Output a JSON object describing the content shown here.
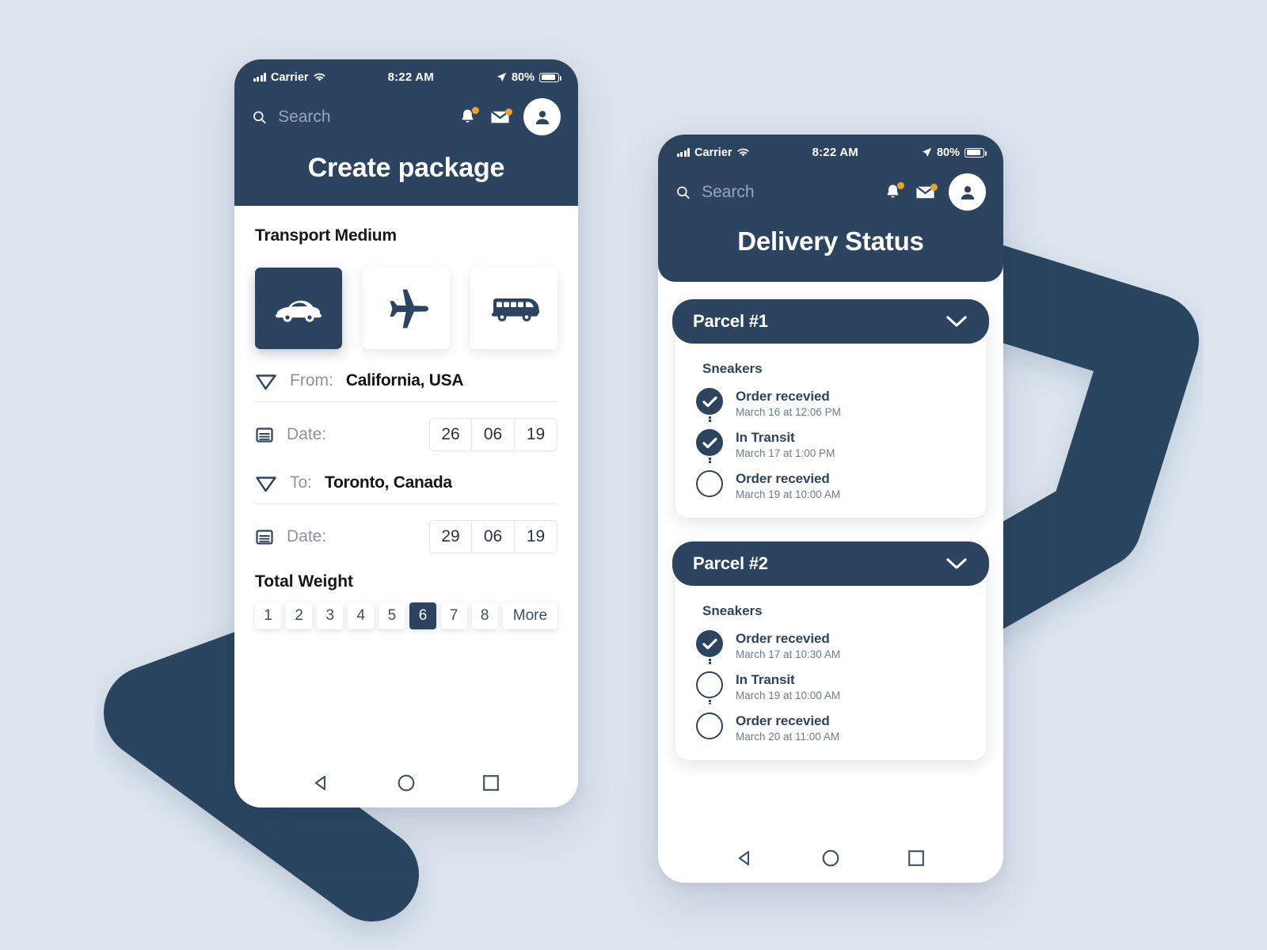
{
  "theme": {
    "page_background": "#dde5ef",
    "navy": "#2c4460",
    "accent_badge": "#f0a12b",
    "card_white": "#ffffff"
  },
  "phone_create": {
    "status_bar": {
      "carrier": "Carrier",
      "time": "8:22 AM",
      "battery_percent": "80%",
      "icons": [
        "signal-bars-icon",
        "wifi-icon",
        "location-arrow-icon",
        "battery-icon"
      ]
    },
    "search": {
      "placeholder": "Search",
      "value": ""
    },
    "header_icons": [
      "bell-icon",
      "mail-icon",
      "avatar-icon"
    ],
    "title": "Create package",
    "transport": {
      "section_label": "Transport Medium",
      "options": [
        {
          "name": "car",
          "icon": "car-icon",
          "selected": true
        },
        {
          "name": "airplane",
          "icon": "airplane-icon",
          "selected": false
        },
        {
          "name": "bus",
          "icon": "bus-icon",
          "selected": false
        }
      ]
    },
    "from": {
      "icon": "send-arrow-icon",
      "label": "From:",
      "value": "California, USA",
      "date_icon": "calendar-icon",
      "date_label": "Date:",
      "date": {
        "day": "26",
        "month": "06",
        "year": "19"
      }
    },
    "to": {
      "icon": "send-arrow-icon",
      "label": "To:",
      "value": "Toronto, Canada",
      "date_icon": "calendar-icon",
      "date_label": "Date:",
      "date": {
        "day": "29",
        "month": "06",
        "year": "19"
      }
    },
    "weight": {
      "section_label": "Total Weight",
      "options": [
        "1",
        "2",
        "3",
        "4",
        "5",
        "6",
        "7",
        "8"
      ],
      "selected": "6",
      "more_label": "More"
    },
    "nav_bar": [
      "back-triangle-icon",
      "home-circle-icon",
      "recents-square-icon"
    ]
  },
  "phone_delivery": {
    "status_bar": {
      "carrier": "Carrier",
      "time": "8:22 AM",
      "battery_percent": "80%",
      "icons": [
        "signal-bars-icon",
        "wifi-icon",
        "location-arrow-icon",
        "battery-icon"
      ]
    },
    "search": {
      "placeholder": "Search",
      "value": ""
    },
    "header_icons": [
      "bell-icon",
      "mail-icon",
      "avatar-icon"
    ],
    "title": "Delivery Status",
    "parcels": [
      {
        "title": "Parcel #1",
        "chevron": "chevron-down-icon",
        "item": "Sneakers",
        "steps": [
          {
            "status": "Order recevied",
            "timestamp": "March 16 at 12:06 PM",
            "done": true
          },
          {
            "status": "In Transit",
            "timestamp": "March 17 at 1:00 PM",
            "done": true
          },
          {
            "status": "Order recevied",
            "timestamp": "March 19 at 10:00 AM",
            "done": false
          }
        ]
      },
      {
        "title": "Parcel #2",
        "chevron": "chevron-down-icon",
        "item": "Sneakers",
        "steps": [
          {
            "status": "Order recevied",
            "timestamp": "March 17 at 10:30 AM",
            "done": true
          },
          {
            "status": "In Transit",
            "timestamp": "March 19 at 10:00 AM",
            "done": false
          },
          {
            "status": "Order recevied",
            "timestamp": "March 20 at 11:00 AM",
            "done": false
          }
        ]
      }
    ],
    "nav_bar": [
      "back-triangle-icon",
      "home-circle-icon",
      "recents-square-icon"
    ]
  }
}
